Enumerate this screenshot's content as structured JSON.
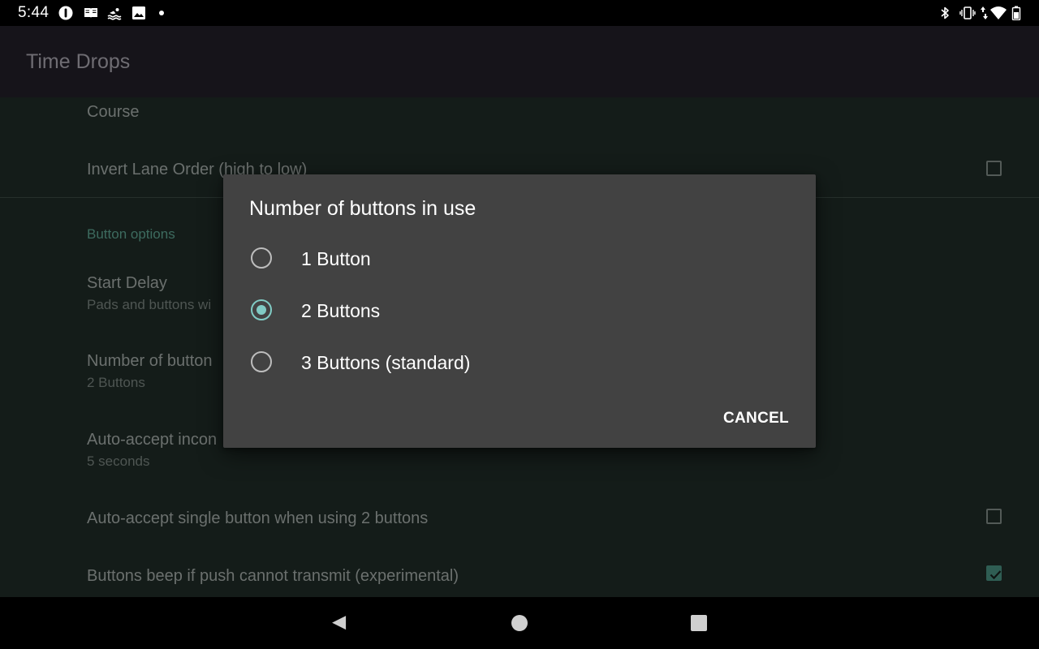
{
  "status_bar": {
    "time": "5:44",
    "left_icons": [
      "alert-icon",
      "book-icon",
      "swimmer-icon",
      "image-icon",
      "dot-icon"
    ],
    "right_icons": [
      "bluetooth-icon",
      "vibrate-icon",
      "data-transfer-icon",
      "wifi-icon",
      "battery-icon"
    ]
  },
  "app_bar": {
    "title": "Time Drops"
  },
  "preferences": {
    "course": {
      "title": "Course"
    },
    "invert_lane_order": {
      "title": "Invert Lane Order (high to low)",
      "checked": false
    },
    "section_header": "Button options",
    "start_delay": {
      "title": "Start Delay",
      "summary": "Pads and buttons wi"
    },
    "number_of_buttons": {
      "title": "Number of button",
      "summary": "2 Buttons"
    },
    "auto_accept_incomplete": {
      "title": "Auto-accept incon",
      "summary": "5 seconds"
    },
    "auto_accept_single": {
      "title": "Auto-accept single button when using 2 buttons",
      "checked": false
    },
    "buttons_beep": {
      "title": "Buttons beep if push cannot transmit (experimental)",
      "checked": true
    }
  },
  "dialog": {
    "title": "Number of buttons in use",
    "options": [
      {
        "label": "1 Button",
        "selected": false
      },
      {
        "label": "2 Buttons",
        "selected": true
      },
      {
        "label": "3 Buttons (standard)",
        "selected": false
      }
    ],
    "cancel_label": "CANCEL"
  },
  "nav_bar": {
    "icons": [
      "back-icon",
      "home-icon",
      "recents-icon"
    ]
  },
  "colors": {
    "accent": "#80cbc4",
    "dialog_background": "#424242",
    "section_header": "#3d6b5f"
  }
}
